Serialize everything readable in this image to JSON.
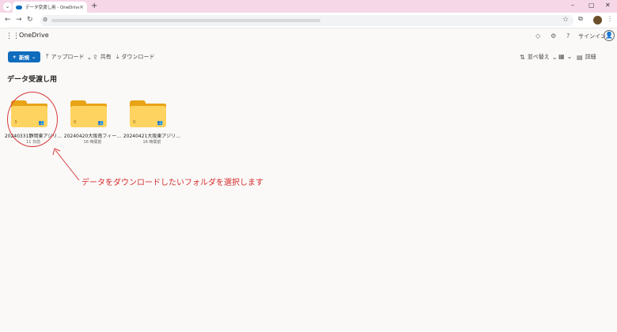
{
  "browser": {
    "tab_title": "データ受渡し用 - OneDrive",
    "tab_close": "×",
    "newtab": "+",
    "window_controls": [
      "–",
      "▢",
      "✕"
    ]
  },
  "onedrive": {
    "brand": "OneDrive",
    "signin": "サインイン"
  },
  "commands": {
    "new_label": "新規",
    "upload": "アップロード",
    "share": "共有",
    "download": "ダウンロード",
    "sort": "並べ替え",
    "details": "詳細"
  },
  "page_title": "データ受渡し用",
  "folders": [
    {
      "name": "20240331静岡東アジリ…",
      "date": "11 日前",
      "count": "3"
    },
    {
      "name": "20240420大阪南フィー…",
      "date": "16 時間前",
      "count": "0"
    },
    {
      "name": "20240421大阪東アジリ…",
      "date": "16 時間前",
      "count": "0"
    }
  ],
  "annotation": {
    "text": "データをダウンロードしたいフォルダを選択します",
    "color": "#d62b2b"
  },
  "colors": {
    "accent": "#0f6cbd",
    "folder": "#ffd35f"
  }
}
